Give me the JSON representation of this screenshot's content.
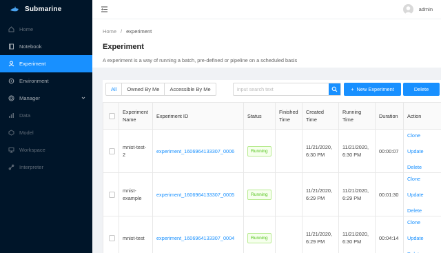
{
  "app": {
    "name": "Submarine"
  },
  "sidebar": {
    "items": [
      {
        "label": "Home",
        "icon": "home-icon"
      },
      {
        "label": "Notebook",
        "icon": "book-icon"
      },
      {
        "label": "Experiment",
        "icon": "experiment-icon"
      },
      {
        "label": "Environment",
        "icon": "environment-icon"
      },
      {
        "label": "Manager",
        "icon": "settings-icon"
      },
      {
        "label": "Data",
        "icon": "bar-chart-icon"
      },
      {
        "label": "Model",
        "icon": "model-icon"
      },
      {
        "label": "Workspace",
        "icon": "desktop-icon"
      },
      {
        "label": "Interpreter",
        "icon": "api-icon"
      }
    ],
    "active_index": 2,
    "accent": "#1890ff"
  },
  "topbar": {
    "user": "admin"
  },
  "breadcrumb": {
    "home": "Home",
    "separator": "/",
    "current": "experiment"
  },
  "page": {
    "title": "Experiment",
    "description": "A experiment is a way of running a batch, pre-defined or pipeline on a scheduled basis"
  },
  "toolbar": {
    "filters": [
      "All",
      "Owned By Me",
      "Accessible By Me"
    ],
    "search_placeholder": "input search text",
    "new_button": "New Experiment",
    "delete_button": "Delete"
  },
  "table": {
    "headers": [
      "Experiment Name",
      "Experiment ID",
      "Status",
      "Finished Time",
      "Created Time",
      "Running Time",
      "Duration",
      "Action"
    ],
    "rows": [
      {
        "name": "mnist-test-2",
        "id": "experiment_1606964133307_0006",
        "status": "Running",
        "finished": "",
        "created": "11/21/2020, 6:30 PM",
        "running": "11/21/2020, 6:30 PM",
        "duration": "00:00:07"
      },
      {
        "name": "mnist-example",
        "id": "experiment_1606964133307_0005",
        "status": "Running",
        "finished": "",
        "created": "11/21/2020, 6:29 PM",
        "running": "11/21/2020, 6:29 PM",
        "duration": "00:01:30"
      },
      {
        "name": "mnist-test",
        "id": "experiment_1606964133307_0004",
        "status": "Running",
        "finished": "",
        "created": "11/21/2020, 6:29 PM",
        "running": "11/21/2020, 6:30 PM",
        "duration": "00:04:14"
      }
    ],
    "actions": [
      "Clone",
      "Update",
      "Delete"
    ]
  }
}
